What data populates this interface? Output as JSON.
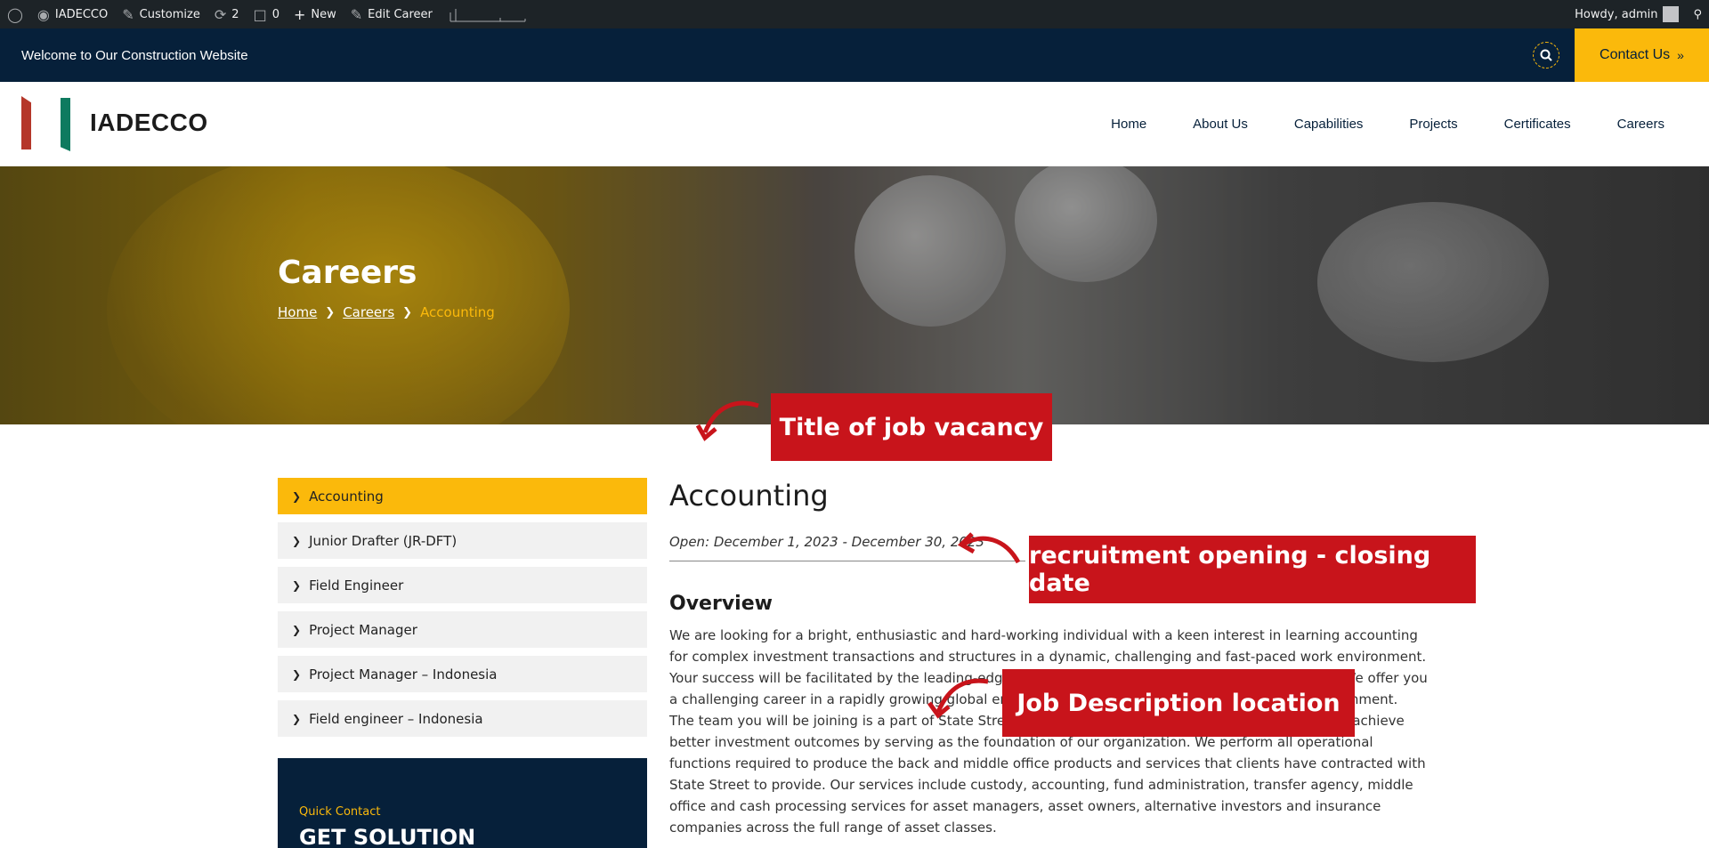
{
  "admin_bar": {
    "site_name": "IADECCO",
    "customize": "Customize",
    "updates_count": "2",
    "comments_count": "0",
    "new_label": "New",
    "edit_label": "Edit Career",
    "howdy": "Howdy, admin"
  },
  "topbar": {
    "welcome": "Welcome to Our Construction Website",
    "contact_label": "Contact Us"
  },
  "header": {
    "brand": "IADECCO",
    "nav": [
      "Home",
      "About Us",
      "Capabilities",
      "Projects",
      "Certificates",
      "Careers"
    ]
  },
  "hero": {
    "title": "Careers",
    "breadcrumb": [
      "Home",
      "Careers",
      "Accounting"
    ]
  },
  "sidebar": {
    "items": [
      "Accounting",
      "Junior Drafter (JR-DFT)",
      "Field Engineer",
      "Project Manager",
      "Project Manager – Indonesia",
      "Field engineer – Indonesia"
    ],
    "quick_contact_label": "Quick Contact",
    "quick_contact_title": "GET SOLUTION"
  },
  "job": {
    "title": "Accounting",
    "open_dates": "Open: December 1, 2023 - December 30, 2023",
    "overview_heading": "Overview",
    "paragraph1": "We are looking for a bright, enthusiastic and hard-working individual with a keen interest in learning accounting for complex investment transactions and structures in a dynamic, challenging and fast-paced work environment. Your success will be facilitated by the leading-edge technology, processes, procedures and controls. We offer you a challenging career in a rapidly growing global environment in a professional yet casual, work environment.",
    "paragraph2": "The team you will be joining is a part of State Street Global Delivery. Global Delivery helps our clients achieve better investment outcomes by serving as the foundation of our organization. We perform all operational functions required to produce the back and middle office products and services that clients have contracted with State Street to provide. Our services include custody, accounting, fund administration, transfer agency, middle office and cash processing services for asset managers, asset owners, alternative investors and insurance companies across the full range of asset classes."
  },
  "annotations": {
    "title_callout": "Title of job vacancy",
    "date_callout": "recruitment opening - closing date",
    "desc_callout": "Job Description location"
  },
  "colors": {
    "navy": "#06203a",
    "accent": "#fbb90b",
    "callout_red": "#c8141b"
  }
}
